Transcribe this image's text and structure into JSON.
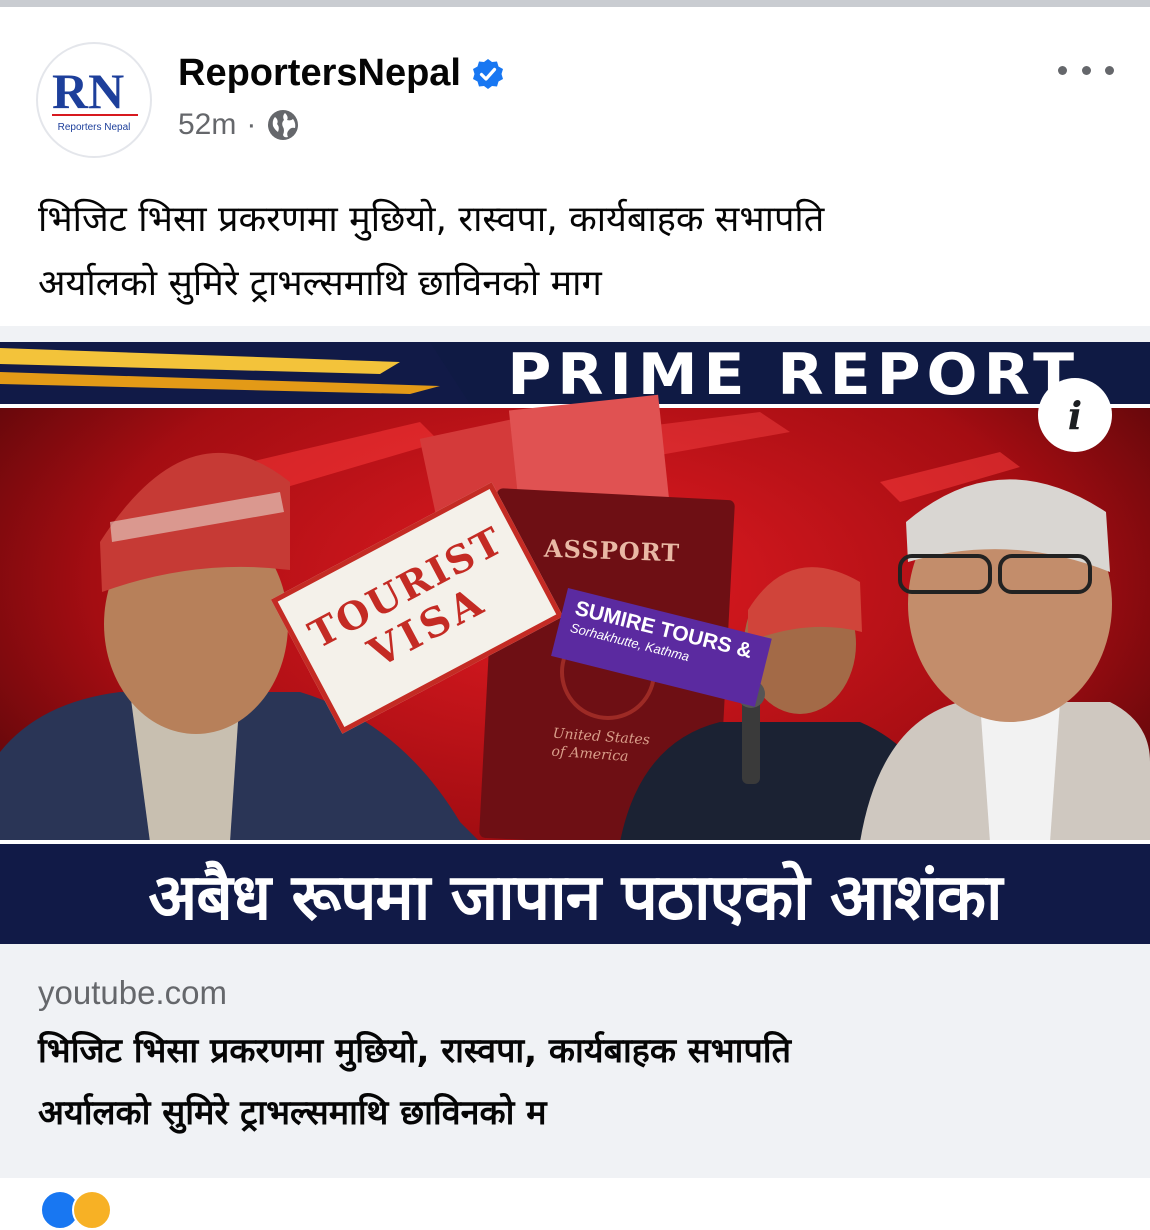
{
  "post": {
    "author": "ReportersNepal",
    "verified_icon": "verified-badge-icon",
    "time": "52m",
    "separator": "·",
    "audience_icon": "globe-icon",
    "more_icon": "more-options-icon",
    "text_lines": [
      "भिजिट भिसा प्रकरणमा मुछियो, रास्वपा, कार्यबाहक सभापति",
      "अर्यालको सुमिरे ट्राभल्समाथि छाविनको माग"
    ]
  },
  "avatar": {
    "logo_letters": "RN",
    "logo_caption": "Reporters Nepal"
  },
  "thumbnail": {
    "banner": "PRIME REPORT",
    "stamp_line1": "TOURIST",
    "stamp_line2": "VISA",
    "passport_word": "ASSPORT",
    "passport_country_line1": "United States",
    "passport_country_line2": "of America",
    "tag_line1": "SUMIRE TOURS &",
    "tag_line2": "Sorhakhutte, Kathma",
    "headline": "अबैध रूपमा जापान पठाएको आशंका",
    "info_label": "i"
  },
  "link_preview": {
    "domain": "youtube.com",
    "title_lines": [
      "भिजिट भिसा प्रकरणमा मुछियो, रास्वपा, कार्यबाहक सभापति",
      "अर्यालको सुमिरे ट्राभल्समाथि छाविनको म"
    ]
  },
  "colors": {
    "brand_red": "#d7191f",
    "brand_blue": "#1d3f9b",
    "verified_blue": "#1877f2",
    "headline_navy": "#111a47",
    "link_box_bg": "#f0f2f5"
  }
}
